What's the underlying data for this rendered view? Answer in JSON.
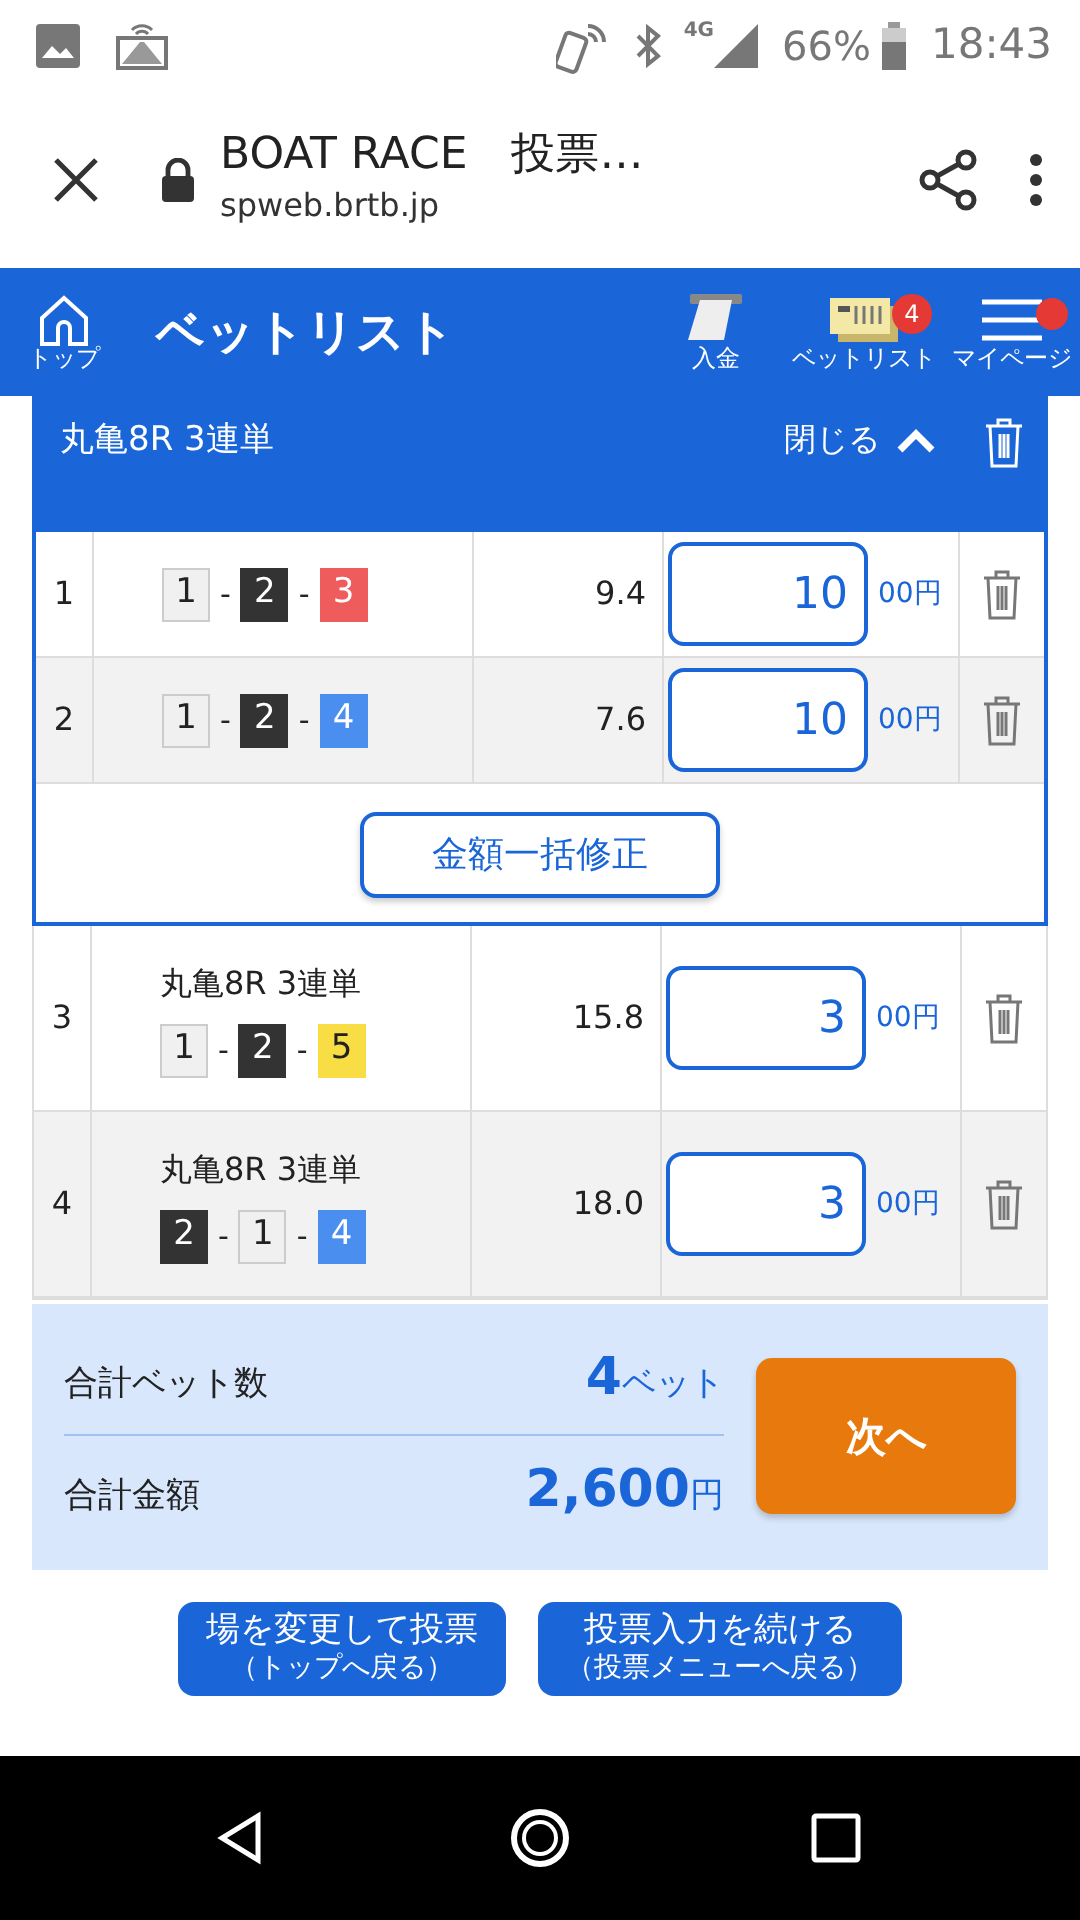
{
  "status_bar": {
    "network": "4G",
    "battery": "66%",
    "time": "18:43"
  },
  "browser": {
    "title": "BOAT RACE　投票…",
    "url": "spweb.brtb.jp"
  },
  "header": {
    "home_label": "トップ",
    "title": "ベットリスト",
    "nav": [
      {
        "kind": "deposit",
        "label": "入金"
      },
      {
        "kind": "betlist",
        "label": "ベットリスト",
        "badge": "4"
      },
      {
        "kind": "menu",
        "label": "マイページ",
        "dot": true
      }
    ]
  },
  "group": {
    "title": "丸亀8R 3連単",
    "toggle": "閉じる",
    "expanded": true,
    "bulk_button": "金額一括修正",
    "bets": [
      {
        "no": "1",
        "boats": [
          {
            "n": "1",
            "color": "#f0f0f0"
          },
          {
            "n": "2",
            "color": "#333333"
          },
          {
            "n": "3",
            "color": "#ee5c5c"
          }
        ],
        "separators": [
          "-",
          "-"
        ],
        "odds": "9.4",
        "amount": "10",
        "unit": "00円"
      },
      {
        "no": "2",
        "boats": [
          {
            "n": "1",
            "color": "#f0f0f0"
          },
          {
            "n": "2",
            "color": "#333333"
          },
          {
            "n": "4",
            "color": "#4a8ff0"
          }
        ],
        "separators": [
          "-",
          "-"
        ],
        "odds": "7.6",
        "amount": "10",
        "unit": "00円"
      }
    ]
  },
  "bets": [
    {
      "no": "3",
      "race": "丸亀8R 3連単",
      "boats": [
        {
          "n": "1",
          "color": "#f0f0f0"
        },
        {
          "n": "2",
          "color": "#333333"
        },
        {
          "n": "5",
          "color": "#f8dd45"
        }
      ],
      "separators": [
        "-",
        "-"
      ],
      "odds": "15.8",
      "amount": "3",
      "unit": "00円"
    },
    {
      "no": "4",
      "race": "丸亀8R 3連単",
      "boats": [
        {
          "n": "2",
          "color": "#333333"
        },
        {
          "n": "1",
          "color": "#f0f0f0"
        },
        {
          "n": "4",
          "color": "#4a8ff0"
        }
      ],
      "separators": [
        "-",
        "-"
      ],
      "odds": "18.0",
      "amount": "3",
      "unit": "00円"
    }
  ],
  "summary": {
    "count_label": "合計ベット数",
    "count": "4",
    "count_unit": "ベット",
    "total_label": "合計金額",
    "total": "2,600",
    "total_unit": "円",
    "next_button": "次へ"
  },
  "actions": [
    {
      "title": "場を変更して投票",
      "sub": "（トップへ戻る）"
    },
    {
      "title": "投票入力を続ける",
      "sub": "（投票メニューへ戻る）"
    }
  ]
}
